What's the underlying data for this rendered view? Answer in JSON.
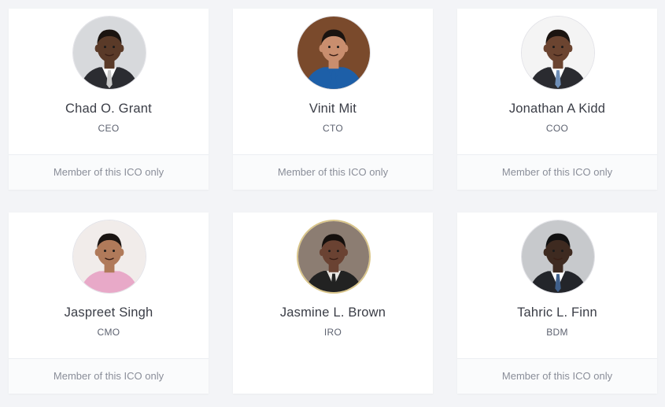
{
  "team": [
    {
      "name": "Chad O. Grant",
      "role": "CEO",
      "note": "Member of this ICO only",
      "skin": "#5a3a28",
      "bg": "#d7d9dc",
      "suit": "#2b2c31",
      "shirt": "#ffffff",
      "tie": "#c9c9c9",
      "hair": "#1b1410"
    },
    {
      "name": "Vinit Mit",
      "role": "CTO",
      "note": "Member of this ICO only",
      "skin": "#c98e6e",
      "bg": "#7a4a2c",
      "suit": "#1d5fa8",
      "shirt": "#1d5fa8",
      "tie": "#1d5fa8",
      "hair": "#1a1410"
    },
    {
      "name": "Jonathan A Kidd",
      "role": "COO",
      "note": "Member of this ICO only",
      "skin": "#6b4430",
      "bg": "#f4f4f4",
      "suit": "#2a2b30",
      "shirt": "#ffffff",
      "tie": "#6f8fb8",
      "hair": "#1b1410"
    },
    {
      "name": "Jaspreet Singh",
      "role": "CMO",
      "note": "Member of this ICO only",
      "skin": "#b07a5a",
      "bg": "#f1ecea",
      "suit": "#e8a9c8",
      "shirt": "#e8a9c8",
      "tie": "#e8a9c8",
      "hair": "#1a1412"
    },
    {
      "name": "Jasmine L. Brown",
      "role": "IRO",
      "note": "",
      "skin": "#6a4232",
      "bg": "#8c7d72",
      "suit": "#222222",
      "shirt": "#e9e6e2",
      "tie": "#222222",
      "hair": "#15100d"
    },
    {
      "name": "Tahric L. Finn",
      "role": "BDM",
      "note": "Member of this ICO only",
      "skin": "#3e2a20",
      "bg": "#c7c9cc",
      "suit": "#23252a",
      "shirt": "#ffffff",
      "tie": "#3f5f8a",
      "hair": "#111111"
    }
  ]
}
